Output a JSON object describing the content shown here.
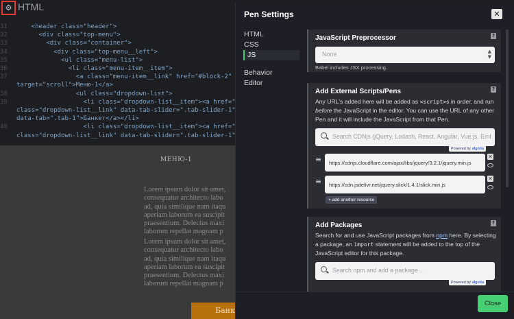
{
  "editor": {
    "title": "HTML",
    "gear_icon": "gear-icon",
    "lines": [
      {
        "ln": "31",
        "code": "    <header class=\"header\">"
      },
      {
        "ln": "32",
        "code": "      <div class=\"top-menu\">"
      },
      {
        "ln": "33",
        "code": "        <div class=\"container\">"
      },
      {
        "ln": "34",
        "code": "          <div class=\"top-menu__left\">"
      },
      {
        "ln": "35",
        "code": "            <ul class=\"menu-list\">"
      },
      {
        "ln": "36",
        "code": "              <li class=\"menu-item__item\">"
      },
      {
        "ln": "37",
        "code": "                <a class=\"menu-item__link\" href=\"#block-2\" data-"
      },
      {
        "ln": "",
        "code": "target=\"scroll\">Меню-1</a>"
      },
      {
        "ln": "38",
        "code": "                <ul class=\"dropdown-list\">"
      },
      {
        "ln": "39",
        "code": "                  <li class=\"dropdown-list__item\"><a href=\"#\""
      },
      {
        "ln": "",
        "code": "class=\"dropdown-list__link\" data-tab-slider=\".tab-slider-1\""
      },
      {
        "ln": "",
        "code": "data-tab=\".tab-1\">Банкет</a></li>"
      },
      {
        "ln": "40",
        "code": "                  <li class=\"dropdown-list__item\"><a href=\"#\""
      },
      {
        "ln": "",
        "code": "class=\"dropdown-list__link\" data-tab-slider=\".tab-slider-1\""
      }
    ]
  },
  "preview": {
    "menu_title": "МЕНЮ-1",
    "paragraph_1": "Lorem ipsum dolor sit amet,\nconsequatur architecto labo\nad, quia similique nam itaqu\naperiam laborum ea suscipit\npraesentium. Delectus maxi\nlaborum repellat magnam p",
    "paragraph_2": "Lorem ipsum dolor sit amet,\nconsequatur architecto labo\nad, quia similique nam itaqu\naperiam laborum ea suscipit\npraesentium. Delectus maxi\nlaborum repellat magnam p",
    "button_label": "Банк"
  },
  "modal": {
    "title": "Pen Settings",
    "close_symbol": "✕",
    "nav": [
      {
        "label": "HTML",
        "active": false
      },
      {
        "label": "CSS",
        "active": false
      },
      {
        "label": "JS",
        "active": true
      },
      {
        "label": "Behavior",
        "active": false
      },
      {
        "label": "Editor",
        "active": false
      }
    ],
    "preprocessor": {
      "title": "JavaScript Preprocessor",
      "help": "?",
      "value": "None",
      "note": "Babel includes JSX processing."
    },
    "external": {
      "title": "Add External Scripts/Pens",
      "help": "?",
      "desc_1": "Any URL's added here will be added as ",
      "desc_code": "<script>",
      "desc_2": "s in order, and run ",
      "desc_em": "before",
      "desc_3": " the JavaScript in the editor. You can use the URL of any other Pen and it will include the JavaScript from that Pen.",
      "search_placeholder": "Search CDNjs (jQuery, Lodash, React, Angular, Vue.js, Ember...",
      "powered_by": "Powered by",
      "algolia": "algolia",
      "scripts": [
        "https://cdnjs.cloudflare.com/ajax/libs/jquery/3.2.1/jquery.min.js",
        "https://cdn.jsdelivr.net/jquery.slick/1.4.1/slick.min.js"
      ],
      "add_button": "+ add another resource"
    },
    "packages": {
      "title": "Add Packages",
      "help": "?",
      "desc_1": "Search for and use JavaScript packages from ",
      "desc_link": "npm",
      "desc_2": " here. By selecting a package, an ",
      "desc_code": "import",
      "desc_3": " statement will be added to the top of the JavaScript editor for this package.",
      "search_placeholder": "Search npm and add a package...",
      "powered_by": "Powered by",
      "algolia": "algolia"
    },
    "close_button": "Close"
  },
  "colors": {
    "accent_green": "#47cf73",
    "highlight_red": "#e53935",
    "preview_orange": "#b8720d"
  }
}
